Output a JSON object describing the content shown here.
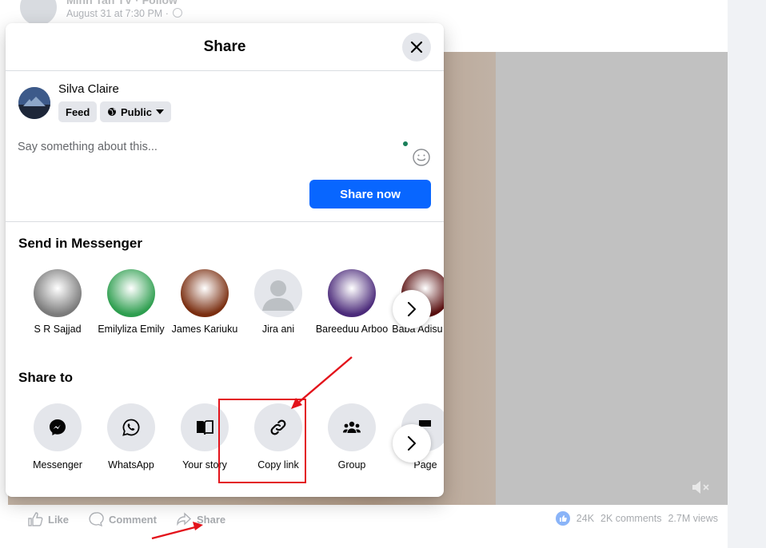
{
  "background_post": {
    "author": "Minh Tan TV · Follow",
    "date": "August 31 at 7:30 PM ·",
    "actions": {
      "like": "Like",
      "comment": "Comment",
      "share": "Share"
    },
    "stats": {
      "likes": "24K",
      "comments": "2K comments",
      "views": "2.7M views"
    },
    "mute_icon": "speaker-muted-icon"
  },
  "dialog": {
    "title": "Share",
    "close_icon": "close-icon",
    "composer": {
      "user_name": "Silva Claire",
      "destination": "Feed",
      "audience": "Public",
      "placeholder": "Say something about this...",
      "share_button": "Share now"
    },
    "messenger": {
      "title": "Send in Messenger",
      "contacts": [
        {
          "name": "S R Sajjad",
          "color": "#7a7a7a"
        },
        {
          "name": "Emilyliza Emily",
          "color": "#2e9e4f"
        },
        {
          "name": "James Kariuku",
          "color": "#7a2e10"
        },
        {
          "name": "Jira ani",
          "color": "#e4e6eb"
        },
        {
          "name": "Bareeduu Arboo",
          "color": "#4b2a7a"
        },
        {
          "name": "Baba Adisu KS",
          "color": "#5a1010"
        }
      ]
    },
    "share_to": {
      "title": "Share to",
      "options": [
        {
          "label": "Messenger",
          "icon": "messenger-icon"
        },
        {
          "label": "WhatsApp",
          "icon": "whatsapp-icon"
        },
        {
          "label": "Your story",
          "icon": "book-icon"
        },
        {
          "label": "Copy link",
          "icon": "link-icon"
        },
        {
          "label": "Group",
          "icon": "group-icon"
        },
        {
          "label": "Page",
          "icon": "flag-icon"
        }
      ]
    }
  },
  "colors": {
    "primary": "#0866ff",
    "annotation_red": "#e3131b",
    "button_gray": "#e4e6eb"
  }
}
